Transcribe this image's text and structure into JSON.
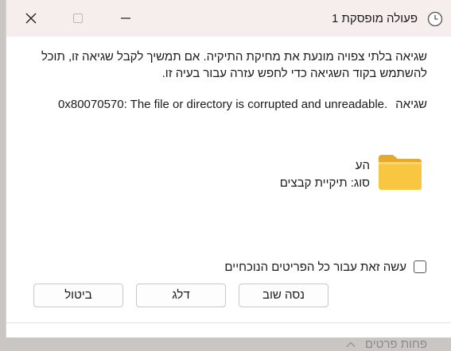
{
  "window": {
    "title": "פעולה מופסקת 1"
  },
  "message": {
    "body": "שגיאה בלתי צפויה מונעת את מחיקת התיקיה. אם תמשיך לקבל שגיאה זו, תוכל להשתמש בקוד השגיאה כדי לחפש עזרה עבור בעיה זו.",
    "error_label": "שגיאה",
    "error_text": "0x80070570: The file or directory is corrupted and unreadable."
  },
  "item": {
    "name": "הע",
    "type": "סוג: תיקיית קבצים",
    "icon": "folder-icon"
  },
  "checkbox": {
    "label": "עשה זאת עבור כל הפריטים הנוכחיים",
    "checked": false
  },
  "buttons": {
    "retry": "נסה שוב",
    "skip": "דלג",
    "cancel": "ביטול"
  },
  "footer": {
    "details_label": "פחות פרטים"
  },
  "colors": {
    "titlebar": "#f6eded",
    "folder": "#f9c642",
    "background": "#ffffff"
  }
}
